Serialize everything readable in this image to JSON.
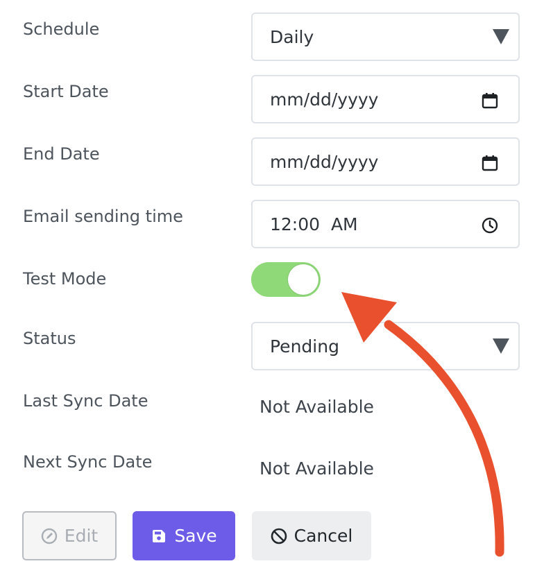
{
  "form": {
    "schedule": {
      "label": "Schedule",
      "value": "Daily"
    },
    "start_date": {
      "label": "Start Date",
      "placeholder": "mm/dd/yyyy"
    },
    "end_date": {
      "label": "End Date",
      "placeholder": "mm/dd/yyyy"
    },
    "email_time": {
      "label": "Email sending time",
      "value": "12:00  AM"
    },
    "test_mode": {
      "label": "Test Mode",
      "on": true
    },
    "status": {
      "label": "Status",
      "value": "Pending"
    },
    "last_sync": {
      "label": "Last Sync Date",
      "value": "Not Available"
    },
    "next_sync": {
      "label": "Next Sync Date",
      "value": "Not Available"
    }
  },
  "buttons": {
    "edit": "Edit",
    "save": "Save",
    "cancel": "Cancel"
  },
  "colors": {
    "toggle_on": "#8fd979",
    "save_bg": "#6c5ce7",
    "arrow": "#e9512e"
  }
}
